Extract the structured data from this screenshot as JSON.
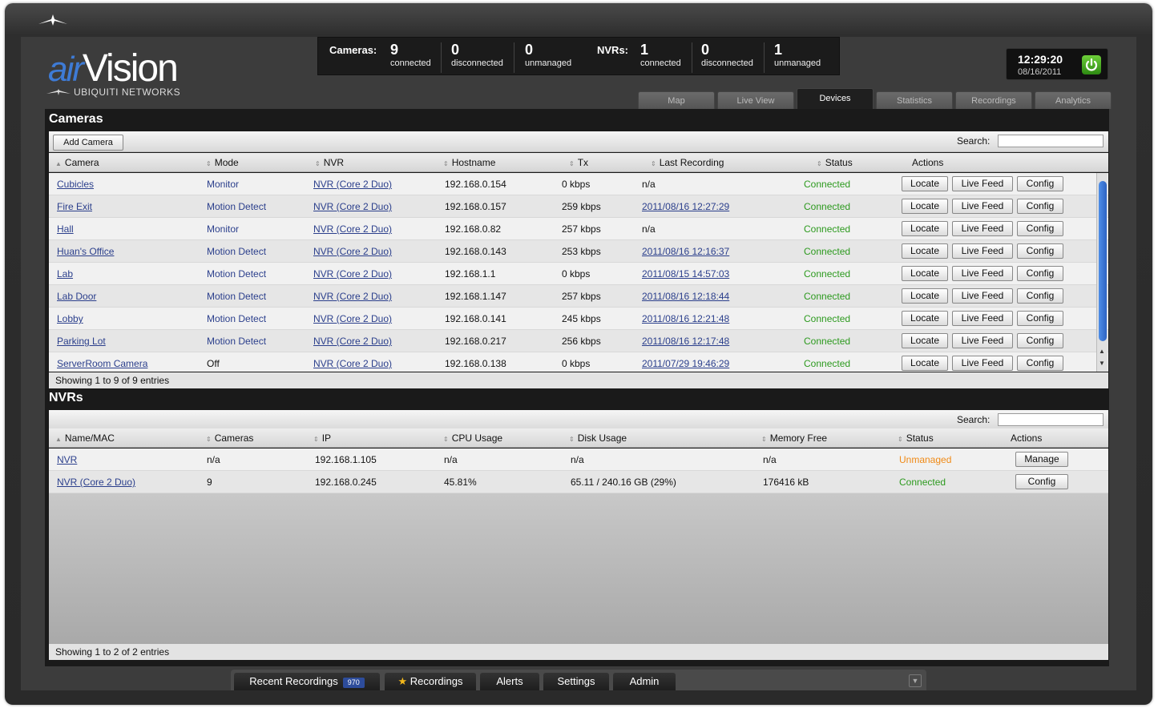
{
  "header": {
    "brand_air": "air",
    "brand_vision": "Vision",
    "brand_sub": "UBIQUITI NETWORKS",
    "clock_time": "12:29:20",
    "clock_date": "08/16/2011"
  },
  "stats": {
    "cameras_label": "Cameras:",
    "cameras_connected": "9",
    "cameras_disconnected": "0",
    "cameras_unmanaged": "0",
    "nvrs_label": "NVRs:",
    "nvrs_connected": "1",
    "nvrs_disconnected": "0",
    "nvrs_unmanaged": "1",
    "connected_label": "connected",
    "disconnected_label": "disconnected",
    "unmanaged_label": "unmanaged"
  },
  "tabs": [
    "Map",
    "Live View",
    "Devices",
    "Statistics",
    "Recordings",
    "Analytics"
  ],
  "active_tab": "Devices",
  "cameras": {
    "title": "Cameras",
    "add_button": "Add Camera",
    "search_label": "Search:",
    "search_value": "",
    "columns": [
      "Camera",
      "Mode",
      "NVR",
      "Hostname",
      "Tx",
      "Last Recording",
      "Status",
      "Actions"
    ],
    "action_labels": [
      "Locate",
      "Live Feed",
      "Config"
    ],
    "rows": [
      {
        "camera": "Cubicles",
        "mode": "Monitor",
        "nvr": "NVR (Core 2 Duo)",
        "hostname": "192.168.0.154",
        "tx": "0 kbps",
        "last": "n/a",
        "status": "Connected"
      },
      {
        "camera": "Fire Exit",
        "mode": "Motion Detect",
        "nvr": "NVR (Core 2 Duo)",
        "hostname": "192.168.0.157",
        "tx": "259 kbps",
        "last": "2011/08/16 12:27:29",
        "status": "Connected"
      },
      {
        "camera": "Hall",
        "mode": "Monitor",
        "nvr": "NVR (Core 2 Duo)",
        "hostname": "192.168.0.82",
        "tx": "257 kbps",
        "last": "n/a",
        "status": "Connected"
      },
      {
        "camera": "Huan's Office",
        "mode": "Motion Detect",
        "nvr": "NVR (Core 2 Duo)",
        "hostname": "192.168.0.143",
        "tx": "253 kbps",
        "last": "2011/08/16 12:16:37",
        "status": "Connected"
      },
      {
        "camera": "Lab",
        "mode": "Motion Detect",
        "nvr": "NVR (Core 2 Duo)",
        "hostname": "192.168.1.1",
        "tx": "0 kbps",
        "last": "2011/08/15 14:57:03",
        "status": "Connected"
      },
      {
        "camera": "Lab Door",
        "mode": "Motion Detect",
        "nvr": "NVR (Core 2 Duo)",
        "hostname": "192.168.1.147",
        "tx": "257 kbps",
        "last": "2011/08/16 12:18:44",
        "status": "Connected"
      },
      {
        "camera": "Lobby",
        "mode": "Motion Detect",
        "nvr": "NVR (Core 2 Duo)",
        "hostname": "192.168.0.141",
        "tx": "245 kbps",
        "last": "2011/08/16 12:21:48",
        "status": "Connected"
      },
      {
        "camera": "Parking Lot",
        "mode": "Motion Detect",
        "nvr": "NVR (Core 2 Duo)",
        "hostname": "192.168.0.217",
        "tx": "256 kbps",
        "last": "2011/08/16 12:17:48",
        "status": "Connected"
      },
      {
        "camera": "ServerRoom Camera",
        "mode": "Off",
        "nvr": "NVR (Core 2 Duo)",
        "hostname": "192.168.0.138",
        "tx": "0 kbps",
        "last": "2011/07/29 19:46:29",
        "status": "Connected"
      }
    ],
    "footer": "Showing 1 to 9 of 9 entries"
  },
  "nvrs": {
    "title": "NVRs",
    "search_label": "Search:",
    "search_value": "",
    "columns": [
      "Name/MAC",
      "Cameras",
      "IP",
      "CPU Usage",
      "Disk Usage",
      "Memory Free",
      "Status",
      "Actions"
    ],
    "rows": [
      {
        "name": "NVR",
        "cameras": "n/a",
        "ip": "192.168.1.105",
        "cpu": "n/a",
        "disk": "n/a",
        "memory": "n/a",
        "status": "Unmanaged",
        "action": "Manage"
      },
      {
        "name": "NVR (Core 2 Duo)",
        "cameras": "9",
        "ip": "192.168.0.245",
        "cpu": "45.81%",
        "disk": "65.11 / 240.16 GB (29%)",
        "memory": "176416 kB",
        "status": "Connected",
        "action": "Config"
      }
    ],
    "footer": "Showing 1 to 2 of 2 entries"
  },
  "dock": {
    "recent_recordings": "Recent Recordings",
    "recent_count": "970",
    "recordings": "Recordings",
    "alerts": "Alerts",
    "settings": "Settings",
    "admin": "Admin"
  },
  "colors": {
    "connected": "#2d9a1f",
    "unmanaged": "#f08a16",
    "link": "#2b3f8c",
    "accent": "#3e7bd6"
  }
}
